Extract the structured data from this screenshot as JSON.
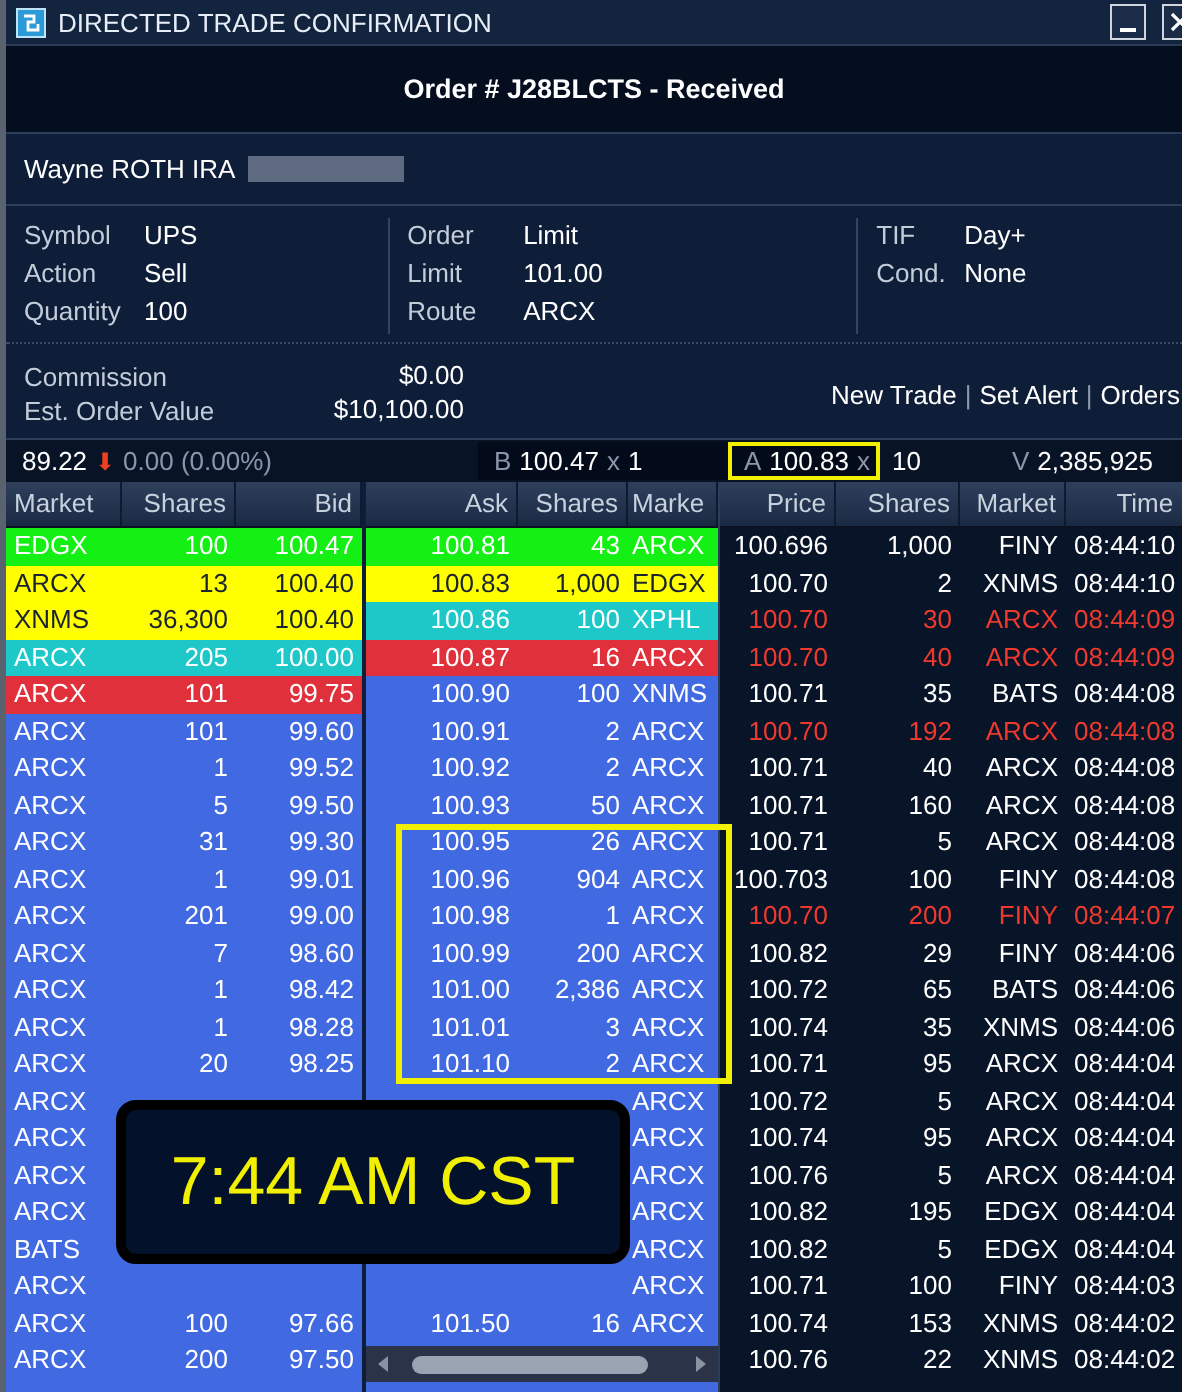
{
  "window": {
    "title": "DIRECTED TRADE CONFIRMATION"
  },
  "order_header": "Order # J28BLCTS - Received",
  "account": {
    "name": "Wayne ROTH IRA"
  },
  "details": [
    [
      {
        "label": "Symbol",
        "value": "UPS"
      },
      {
        "label": "Action",
        "value": "Sell"
      },
      {
        "label": "Quantity",
        "value": "100"
      }
    ],
    [
      {
        "label": "Order",
        "value": "Limit"
      },
      {
        "label": "Limit",
        "value": "101.00"
      },
      {
        "label": "Route",
        "value": "ARCX"
      }
    ],
    [
      {
        "label": "TIF",
        "value": "Day+"
      },
      {
        "label": "Cond.",
        "value": "None"
      }
    ]
  ],
  "costs": [
    {
      "label": "Commission",
      "value": "$0.00"
    },
    {
      "label": "Est. Order Value",
      "value": "$10,100.00"
    }
  ],
  "links": [
    "New Trade",
    "Set Alert",
    "Orders"
  ],
  "link_separator": "|",
  "quote": {
    "last": "89.22",
    "arrow": "⬇",
    "change": "0.00 (0.00%)",
    "sides": [
      {
        "label": "B",
        "price": "100.47",
        "sep": "x",
        "size": "1",
        "highlighted": false
      },
      {
        "label": "A",
        "price": "100.83",
        "sep": "x",
        "size": "10",
        "highlighted": true
      }
    ],
    "volume": {
      "label": "V",
      "value": "2,385,925"
    }
  },
  "bid_book": {
    "columns": [
      "Market",
      "Shares",
      "Bid"
    ],
    "rows": [
      {
        "market": "EDGX",
        "shares": "100",
        "price": "100.47",
        "color": "#14f014"
      },
      {
        "market": "ARCX",
        "shares": "13",
        "price": "100.40",
        "color": "#ffff00"
      },
      {
        "market": "XNMS",
        "shares": "36,300",
        "price": "100.40",
        "color": "#ffff00"
      },
      {
        "market": "ARCX",
        "shares": "205",
        "price": "100.00",
        "color": "#1ec8c8"
      },
      {
        "market": "ARCX",
        "shares": "101",
        "price": "99.75",
        "color": "#e0303c"
      },
      {
        "market": "ARCX",
        "shares": "101",
        "price": "99.60",
        "color": "#4169e1"
      },
      {
        "market": "ARCX",
        "shares": "1",
        "price": "99.52",
        "color": "#4169e1"
      },
      {
        "market": "ARCX",
        "shares": "5",
        "price": "99.50",
        "color": "#4169e1"
      },
      {
        "market": "ARCX",
        "shares": "31",
        "price": "99.30",
        "color": "#4169e1"
      },
      {
        "market": "ARCX",
        "shares": "1",
        "price": "99.01",
        "color": "#4169e1"
      },
      {
        "market": "ARCX",
        "shares": "201",
        "price": "99.00",
        "color": "#4169e1"
      },
      {
        "market": "ARCX",
        "shares": "7",
        "price": "98.60",
        "color": "#4169e1"
      },
      {
        "market": "ARCX",
        "shares": "1",
        "price": "98.42",
        "color": "#4169e1"
      },
      {
        "market": "ARCX",
        "shares": "1",
        "price": "98.28",
        "color": "#4169e1"
      },
      {
        "market": "ARCX",
        "shares": "20",
        "price": "98.25",
        "color": "#4169e1"
      },
      {
        "market": "ARCX",
        "color": "#4169e1"
      },
      {
        "market": "ARCX",
        "color": "#4169e1"
      },
      {
        "market": "ARCX",
        "color": "#4169e1"
      },
      {
        "market": "ARCX",
        "color": "#4169e1"
      },
      {
        "market": "BATS",
        "color": "#4169e1"
      },
      {
        "market": "ARCX",
        "color": "#4169e1"
      },
      {
        "market": "ARCX",
        "shares": "100",
        "price": "97.66",
        "color": "#4169e1"
      },
      {
        "market": "ARCX",
        "shares": "200",
        "price": "97.50",
        "color": "#4169e1"
      }
    ]
  },
  "ask_book": {
    "columns": [
      "Ask",
      "Shares",
      "Marke"
    ],
    "rows": [
      {
        "price": "100.81",
        "shares": "43",
        "market": "ARCX",
        "color": "#14f014",
        "highlighted": false
      },
      {
        "price": "100.83",
        "shares": "1,000",
        "market": "EDGX",
        "color": "#ffff00",
        "highlighted": false
      },
      {
        "price": "100.86",
        "shares": "100",
        "market": "XPHL",
        "color": "#1ec8c8",
        "highlighted": false
      },
      {
        "price": "100.87",
        "shares": "16",
        "market": "ARCX",
        "color": "#e0303c",
        "highlighted": false
      },
      {
        "price": "100.90",
        "shares": "100",
        "market": "XNMS",
        "color": "#4169e1",
        "highlighted": false
      },
      {
        "price": "100.91",
        "shares": "2",
        "market": "ARCX",
        "color": "#4169e1",
        "highlighted": false
      },
      {
        "price": "100.92",
        "shares": "2",
        "market": "ARCX",
        "color": "#4169e1",
        "highlighted": false
      },
      {
        "price": "100.93",
        "shares": "50",
        "market": "ARCX",
        "color": "#4169e1",
        "highlighted": false
      },
      {
        "price": "100.95",
        "shares": "26",
        "market": "ARCX",
        "color": "#4169e1",
        "highlighted": true
      },
      {
        "price": "100.96",
        "shares": "904",
        "market": "ARCX",
        "color": "#4169e1",
        "highlighted": true
      },
      {
        "price": "100.98",
        "shares": "1",
        "market": "ARCX",
        "color": "#4169e1",
        "highlighted": true
      },
      {
        "price": "100.99",
        "shares": "200",
        "market": "ARCX",
        "color": "#4169e1",
        "highlighted": true
      },
      {
        "price": "101.00",
        "shares": "2,386",
        "market": "ARCX",
        "color": "#4169e1",
        "highlighted": true
      },
      {
        "price": "101.01",
        "shares": "3",
        "market": "ARCX",
        "color": "#4169e1",
        "highlighted": true
      },
      {
        "price": "101.10",
        "shares": "2",
        "market": "ARCX",
        "color": "#4169e1",
        "highlighted": true
      },
      {
        "market": "ARCX",
        "color": "#4169e1",
        "highlighted": false
      },
      {
        "market": "ARCX",
        "color": "#4169e1",
        "highlighted": false
      },
      {
        "market": "ARCX",
        "color": "#4169e1",
        "highlighted": false
      },
      {
        "market": "ARCX",
        "color": "#4169e1",
        "highlighted": false
      },
      {
        "market": "ARCX",
        "color": "#4169e1",
        "highlighted": false
      },
      {
        "market": "ARCX",
        "color": "#4169e1",
        "highlighted": false
      },
      {
        "price": "101.50",
        "shares": "16",
        "market": "ARCX",
        "color": "#4169e1",
        "highlighted": false
      }
    ]
  },
  "time_sales": {
    "columns": [
      "Price",
      "Shares",
      "Market",
      "Time"
    ],
    "rows": [
      {
        "price": "100.696",
        "shares": "1,000",
        "market": "FINY",
        "time": "08:44:10",
        "color": "#ffffff"
      },
      {
        "price": "100.70",
        "shares": "2",
        "market": "XNMS",
        "time": "08:44:10",
        "color": "#ffffff"
      },
      {
        "price": "100.70",
        "shares": "30",
        "market": "ARCX",
        "time": "08:44:09",
        "color": "#f0392e"
      },
      {
        "price": "100.70",
        "shares": "40",
        "market": "ARCX",
        "time": "08:44:09",
        "color": "#f0392e"
      },
      {
        "price": "100.71",
        "shares": "35",
        "market": "BATS",
        "time": "08:44:08",
        "color": "#ffffff"
      },
      {
        "price": "100.70",
        "shares": "192",
        "market": "ARCX",
        "time": "08:44:08",
        "color": "#f0392e"
      },
      {
        "price": "100.71",
        "shares": "40",
        "market": "ARCX",
        "time": "08:44:08",
        "color": "#ffffff"
      },
      {
        "price": "100.71",
        "shares": "160",
        "market": "ARCX",
        "time": "08:44:08",
        "color": "#ffffff"
      },
      {
        "price": "100.71",
        "shares": "5",
        "market": "ARCX",
        "time": "08:44:08",
        "color": "#ffffff"
      },
      {
        "price": "100.703",
        "shares": "100",
        "market": "FINY",
        "time": "08:44:08",
        "color": "#ffffff"
      },
      {
        "price": "100.70",
        "shares": "200",
        "market": "FINY",
        "time": "08:44:07",
        "color": "#f0392e"
      },
      {
        "price": "100.82",
        "shares": "29",
        "market": "FINY",
        "time": "08:44:06",
        "color": "#ffffff"
      },
      {
        "price": "100.72",
        "shares": "65",
        "market": "BATS",
        "time": "08:44:06",
        "color": "#ffffff"
      },
      {
        "price": "100.74",
        "shares": "35",
        "market": "XNMS",
        "time": "08:44:06",
        "color": "#ffffff"
      },
      {
        "price": "100.71",
        "shares": "95",
        "market": "ARCX",
        "time": "08:44:04",
        "color": "#ffffff"
      },
      {
        "price": "100.72",
        "shares": "5",
        "market": "ARCX",
        "time": "08:44:04",
        "color": "#ffffff"
      },
      {
        "price": "100.74",
        "shares": "95",
        "market": "ARCX",
        "time": "08:44:04",
        "color": "#ffffff"
      },
      {
        "price": "100.76",
        "shares": "5",
        "market": "ARCX",
        "time": "08:44:04",
        "color": "#ffffff"
      },
      {
        "price": "100.82",
        "shares": "195",
        "market": "EDGX",
        "time": "08:44:04",
        "color": "#ffffff"
      },
      {
        "price": "100.82",
        "shares": "5",
        "market": "EDGX",
        "time": "08:44:04",
        "color": "#ffffff"
      },
      {
        "price": "100.71",
        "shares": "100",
        "market": "FINY",
        "time": "08:44:03",
        "color": "#ffffff"
      },
      {
        "price": "100.74",
        "shares": "153",
        "market": "XNMS",
        "time": "08:44:02",
        "color": "#ffffff"
      },
      {
        "price": "100.76",
        "shares": "22",
        "market": "XNMS",
        "time": "08:44:02",
        "color": "#ffffff"
      }
    ]
  },
  "clock": {
    "text": "7:44 AM CST"
  }
}
